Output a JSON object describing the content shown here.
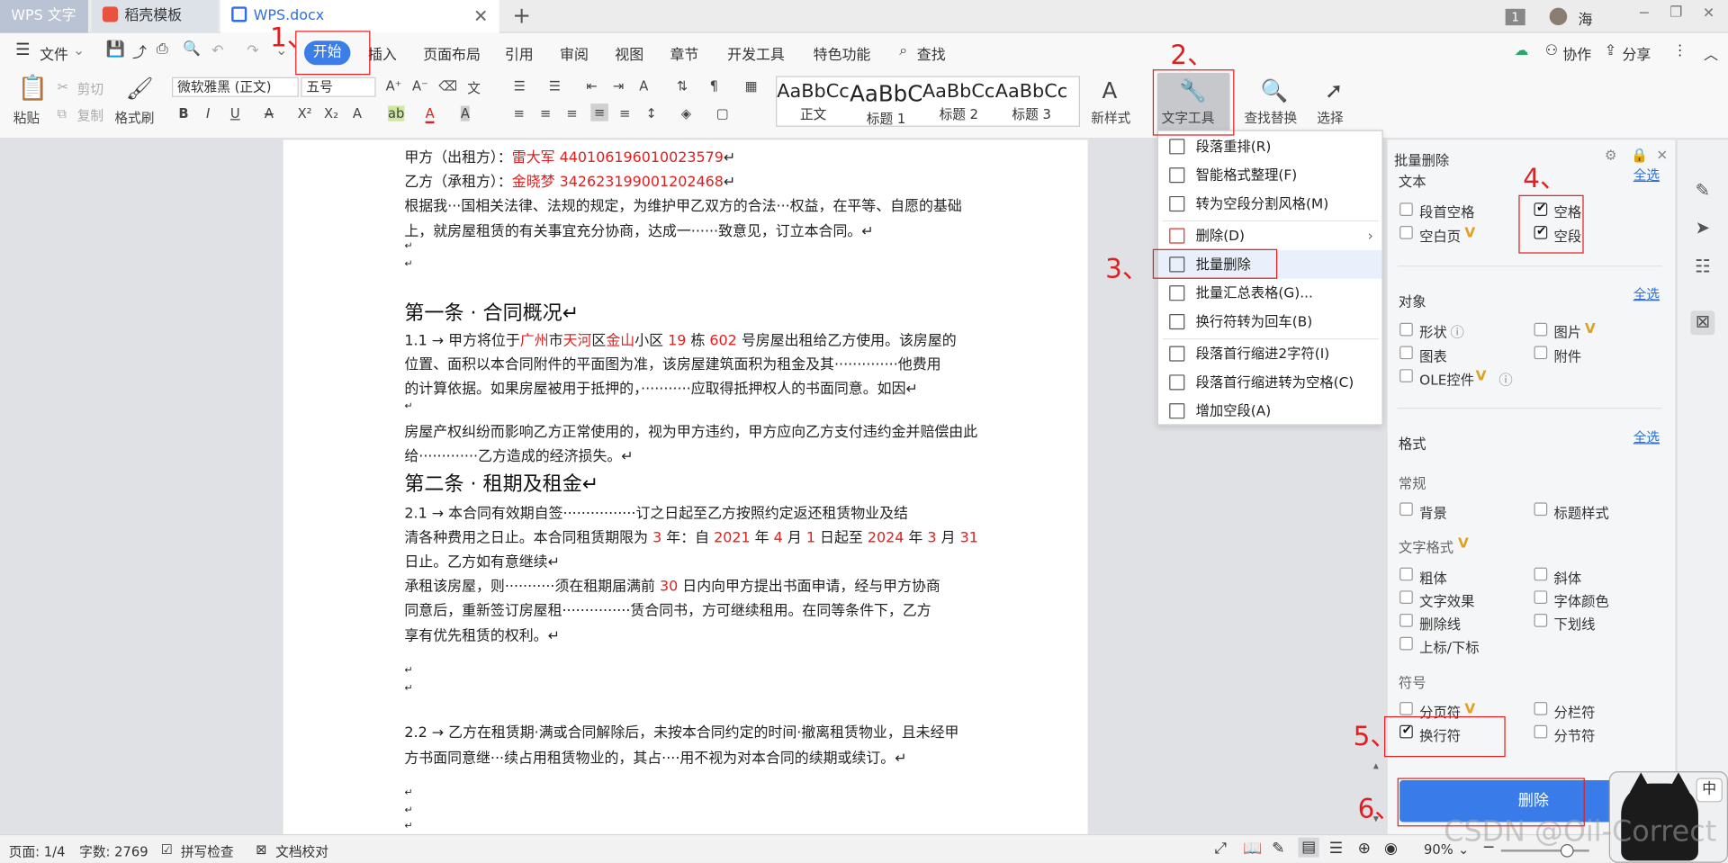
{
  "tabs": {
    "app": "WPS 文字",
    "template": "稻壳模板",
    "doc": "WPS.docx",
    "close": "✕",
    "new": "+"
  },
  "window": {
    "badge": "1",
    "user": "海",
    "min": "─",
    "max": "❐",
    "close": "✕"
  },
  "menu": {
    "file": "文件",
    "start": "开始",
    "insert": "插入",
    "layout": "页面布局",
    "ref": "引用",
    "review": "审阅",
    "view": "视图",
    "chapter": "章节",
    "dev": "开发工具",
    "special": "特色功能",
    "search": "查找",
    "collab": "协作",
    "share": "分享"
  },
  "toolbar": {
    "paste": "粘贴",
    "cut": "剪切",
    "copy": "复制",
    "format_painter": "格式刷",
    "font": "微软雅黑 (正文)",
    "size": "五号",
    "styles": [
      {
        "sample": "AaBbCcD",
        "label": "正文"
      },
      {
        "sample": "AaBbC",
        "label": "标题 1"
      },
      {
        "sample": "AaBbCcD",
        "label": "标题 2"
      },
      {
        "sample": "AaBbCcD",
        "label": "标题 3"
      }
    ],
    "new_style": "新样式",
    "text_tools": "文字工具",
    "find_replace": "查找替换",
    "select": "选择"
  },
  "doc": {
    "l1a": "甲方（出租方）：",
    "l1b": "雷大军 440106196010023579",
    "l1c": "↵",
    "l2a": "乙方（承租方）：",
    "l2b": "金晓梦 342623199001202468",
    "l2c": "↵",
    "l3": "根据我···国相关法律、法规的规定，为维护甲乙双方的合法···权益，在平等、自愿的基础",
    "l4": "上，就房屋租赁的有关事宜充分协商，达成一······致意见，订立本合同。↵",
    "l5": "↵",
    "l6": "↵",
    "h1": "第一条 · 合同概况↵",
    "p1a": "1.1 → 甲方将位于",
    "p1b": "广州",
    "p1c": "市",
    "p1d": "天河",
    "p1e": "区",
    "p1f": "金山",
    "p1g": "小区 ",
    "p1h": "19",
    "p1i": " 栋 ",
    "p1j": "602",
    "p1k": " 号房屋出租给乙方使用。该房屋的",
    "p2": "位置、面积以本合同附件的平面图为准，该房屋建筑面积为租金及其··············他费用",
    "p3": "的计算依据。如果房屋被用于抵押的，···········应取得抵押权人的书面同意。如因↵",
    "p4": "↵",
    "p5": "房屋产权纠纷而影响乙方正常使用的，视为甲方违约，甲方应向乙方支付违约金并赔偿由此",
    "p6": "给·············乙方造成的经济损失。↵",
    "h2": "第二条 · 租期及租金↵",
    "q1": "2.1 → 本合同有效期自签················订之日起至乙方按照约定返还租赁物业及结",
    "q2a": "清各种费用之日止。本合同租赁期限为 ",
    "q2b": "3",
    "q2c": " 年：自 ",
    "q2d": "2021",
    "q2e": " 年 ",
    "q2f": "4",
    "q2g": " 月 ",
    "q2h": "1",
    "q2i": " 日起至 ",
    "q2j": "2024",
    "q2k": " 年 ",
    "q2l": "3",
    "q2m": " 月 ",
    "q2n": "31",
    "q3": "日止。乙方如有意继续↵",
    "q4a": "承租该房屋，则···········须在租期届满前 ",
    "q4b": "30",
    "q4c": " 日内向甲方提出书面申请，经与甲方协商",
    "q5": "同意后，重新签订房屋租···············赁合同书，方可继续租用。在同等条件下，乙方",
    "q6": "享有优先租赁的权利。↵",
    "q7": "↵",
    "q8": "↵",
    "r1": "2.2 → 乙方在租赁期·满或合同解除后，未按本合同约定的时间·撤离租赁物业，且未经甲",
    "r2": "方书面同意继···续占用租赁物业的，其占····用不视为对本合同的续期或续订。↵",
    "r3": "↵",
    "r4": "↵",
    "r5": "↵"
  },
  "dropdown": [
    "段落重排(R)",
    "智能格式整理(F)",
    "转为空段分割风格(M)",
    "删除(D)",
    "批量删除",
    "批量汇总表格(G)...",
    "换行符转为回车(B)",
    "段落首行缩进2字符(I)",
    "段落首行缩进转为空格(C)",
    "增加空段(A)"
  ],
  "panel": {
    "title": "批量删除",
    "text": "文本",
    "select_all": "全选",
    "lead_space": "段首空格",
    "space": "空格",
    "blank_page": "空白页",
    "blank_para": "空段",
    "objects": "对象",
    "shape": "形状",
    "picture": "图片",
    "chart": "图表",
    "attachment": "附件",
    "ole": "OLE控件",
    "format": "格式",
    "normal": "常规",
    "background": "背景",
    "heading_style": "标题样式",
    "text_format": "文字格式",
    "bold": "粗体",
    "italic": "斜体",
    "effect": "文字效果",
    "font_color": "字体颜色",
    "strike": "删除线",
    "underline": "下划线",
    "supsub": "上标/下标",
    "symbols": "符号",
    "page_break": "分页符",
    "column_break": "分栏符",
    "line_break": "换行符",
    "section_break": "分节符",
    "delete": "删除",
    "checks": {
      "space": true,
      "blank_para": true,
      "line_break": true
    }
  },
  "status": {
    "page": "页面: 1/4",
    "words": "字数: 2769",
    "spell": "拼写检查",
    "proof": "文档校对",
    "zoom": "90%",
    "ime": "中"
  },
  "annotations": [
    "1、",
    "2、",
    "3、",
    "4、",
    "5、",
    "6、"
  ],
  "watermark": "CSDN @Oil-Correct"
}
